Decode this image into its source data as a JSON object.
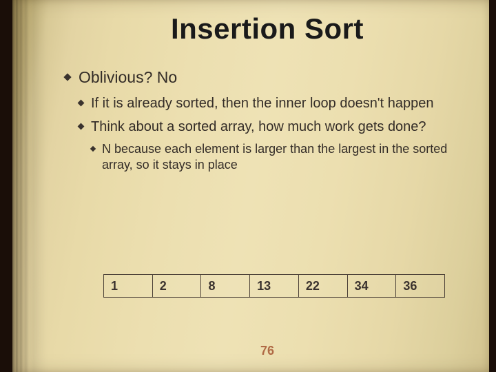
{
  "slide": {
    "title": "Insertion Sort",
    "page_number": "76",
    "bullets": [
      {
        "text": "Oblivious?  No",
        "children": [
          {
            "text": "If it is already sorted, then the inner loop doesn't happen"
          },
          {
            "text": "Think about a sorted array, how much work gets done?",
            "children": [
              {
                "text": "N because each element is larger than the largest in the sorted array, so it stays in place"
              }
            ]
          }
        ]
      }
    ],
    "array": [
      "1",
      "2",
      "8",
      "13",
      "22",
      "34",
      "36"
    ]
  }
}
